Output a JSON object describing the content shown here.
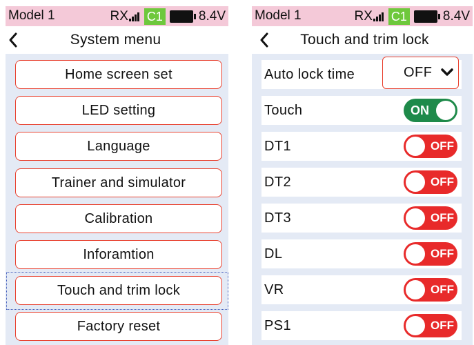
{
  "status_bar": {
    "model_name": "Model 1",
    "rx_label": "RX",
    "signal_icon": "signal-bars-icon",
    "channel_badge": "C1",
    "battery_icon": "battery-icon",
    "voltage": "8.4V"
  },
  "left": {
    "title": "System menu",
    "back_icon": "chevron-left-icon",
    "focused_item": "Touch and trim lock",
    "menu_items": [
      "Home screen set",
      "LED setting",
      "Language",
      "Trainer and simulator",
      "Calibration",
      "Inforamtion",
      "Touch and trim lock",
      "Factory reset"
    ]
  },
  "right": {
    "title": "Touch and trim lock",
    "back_icon": "chevron-left-icon",
    "auto_lock": {
      "label": "Auto lock time",
      "value": "OFF",
      "icon": "chevron-down-icon"
    },
    "switches": [
      {
        "label": "Touch",
        "state": "ON"
      },
      {
        "label": "DT1",
        "state": "OFF"
      },
      {
        "label": "DT2",
        "state": "OFF"
      },
      {
        "label": "DT3",
        "state": "OFF"
      },
      {
        "label": "DL",
        "state": "OFF"
      },
      {
        "label": "VR",
        "state": "OFF"
      },
      {
        "label": "PS1",
        "state": "OFF"
      }
    ]
  },
  "colors": {
    "status_bar_bg": "#f4c9d8",
    "badge_green": "#6ec83c",
    "accent_red": "#e8412f",
    "toggle_on": "#1e8a4a",
    "toggle_off": "#e82a2a",
    "list_bg": "#e4eaf5",
    "focus_ring": "#3a56b8"
  }
}
